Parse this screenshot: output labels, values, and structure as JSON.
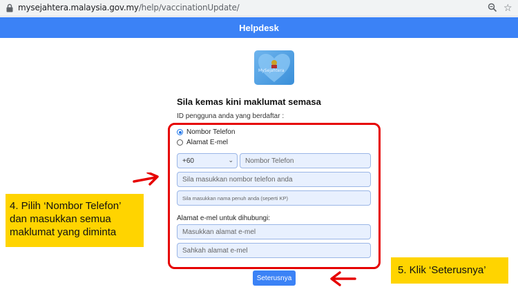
{
  "browser": {
    "url_host": "mysejahtera.malaysia.gov.my",
    "url_path": "/help/vaccinationUpdate/"
  },
  "header": {
    "title": "Helpdesk"
  },
  "logo": {
    "text": "MySejahtera"
  },
  "form": {
    "title": "Sila kemas kini maklumat semasa",
    "user_id_label": "ID pengguna anda yang berdaftar :",
    "radio_options": [
      {
        "label": "Nombor Telefon",
        "selected": true
      },
      {
        "label": "Alamat E-mel",
        "selected": false
      }
    ],
    "country_code": "+60",
    "phone_placeholder": "Nombor Telefon",
    "confirm_phone_placeholder": "Sila masukkan nombor telefon anda",
    "full_name_placeholder": "Sila masukkan nama penuh anda (seperti KP)",
    "contact_email_label": "Alamat e-mel untuk dihubungi:",
    "email_placeholder": "Masukkan alamat e-mel",
    "confirm_email_placeholder": "Sahkah alamat e-mel",
    "submit_label": "Seterusnya"
  },
  "annotations": {
    "callout_step4": "4. Pilih ‘Nombor Telefon’ dan masukkan semua maklumat yang diminta",
    "callout_step5": "5. Klik ‘Seterusnya’",
    "highlight_color": "#e60000",
    "callout_color": "#ffd400"
  },
  "colors": {
    "primary": "#3b82f6",
    "field_bg": "#e8f0fe"
  }
}
